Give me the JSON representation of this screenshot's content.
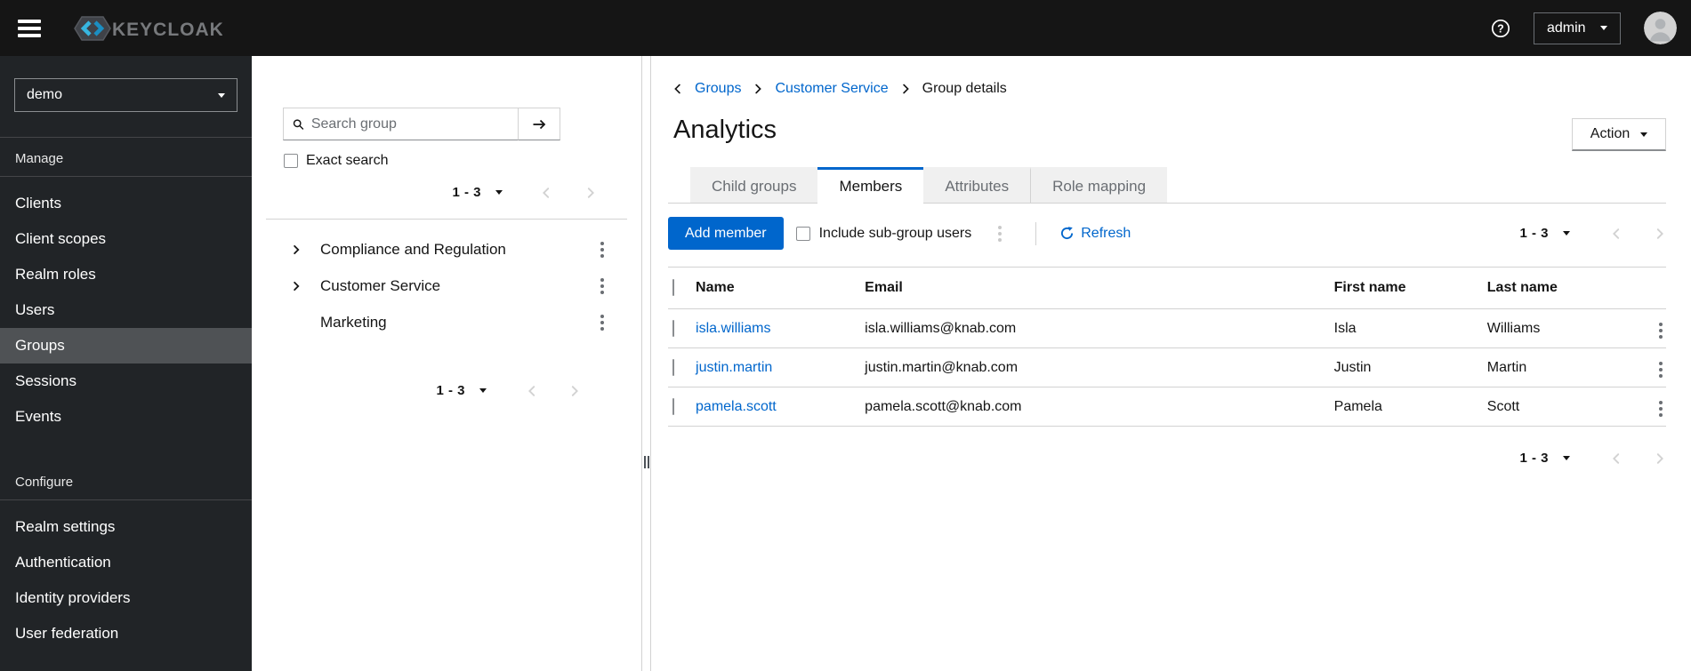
{
  "topbar": {
    "brand": "KEYCLOAK",
    "user_menu": "admin"
  },
  "sidebar": {
    "realm_selector": "demo",
    "manage": {
      "label": "Manage",
      "items": [
        "Clients",
        "Client scopes",
        "Realm roles",
        "Users",
        "Groups",
        "Sessions",
        "Events"
      ],
      "selected": "Groups"
    },
    "configure": {
      "label": "Configure",
      "items": [
        "Realm settings",
        "Authentication",
        "Identity providers",
        "User federation"
      ]
    }
  },
  "groups_panel": {
    "search": {
      "placeholder": "Search group"
    },
    "exact_search_label": "Exact search",
    "pagination_top": "1 - 3",
    "pagination_bottom": "1 - 3",
    "tree": [
      {
        "label": "Compliance and Regulation",
        "expandable": true
      },
      {
        "label": "Customer Service",
        "expandable": true
      },
      {
        "label": "Marketing",
        "expandable": false
      }
    ]
  },
  "main": {
    "breadcrumb": {
      "items": [
        {
          "label": "Groups",
          "link": true
        },
        {
          "label": "Customer Service",
          "link": true
        },
        {
          "label": "Group details",
          "link": false
        }
      ]
    },
    "title": "Analytics",
    "action_button": "Action",
    "tabs": [
      {
        "label": "Child groups"
      },
      {
        "label": "Members"
      },
      {
        "label": "Attributes"
      },
      {
        "label": "Role mapping"
      }
    ],
    "active_tab": "Members",
    "toolbar": {
      "add_member_label": "Add member",
      "include_subgroup_label": "Include sub-group users",
      "refresh_label": "Refresh",
      "pagination": "1 - 3"
    },
    "table": {
      "columns": [
        "Name",
        "Email",
        "First name",
        "Last name"
      ],
      "rows": [
        {
          "name": "isla.williams",
          "email": "isla.williams@knab.com",
          "first_name": "Isla",
          "last_name": "Williams"
        },
        {
          "name": "justin.martin",
          "email": "justin.martin@knab.com",
          "first_name": "Justin",
          "last_name": "Martin"
        },
        {
          "name": "pamela.scott",
          "email": "pamela.scott@knab.com",
          "first_name": "Pamela",
          "last_name": "Scott"
        }
      ]
    },
    "pagination_bottom": "1 - 3"
  },
  "colors": {
    "accent": "#0066cc",
    "link": "#0066cc",
    "topbar_bg": "#151515",
    "sidebar_bg": "#212427",
    "sidebar_selected": "#4f5255",
    "tab_inactive_bg": "#f0f0f0",
    "border": "#d2d2d2"
  }
}
